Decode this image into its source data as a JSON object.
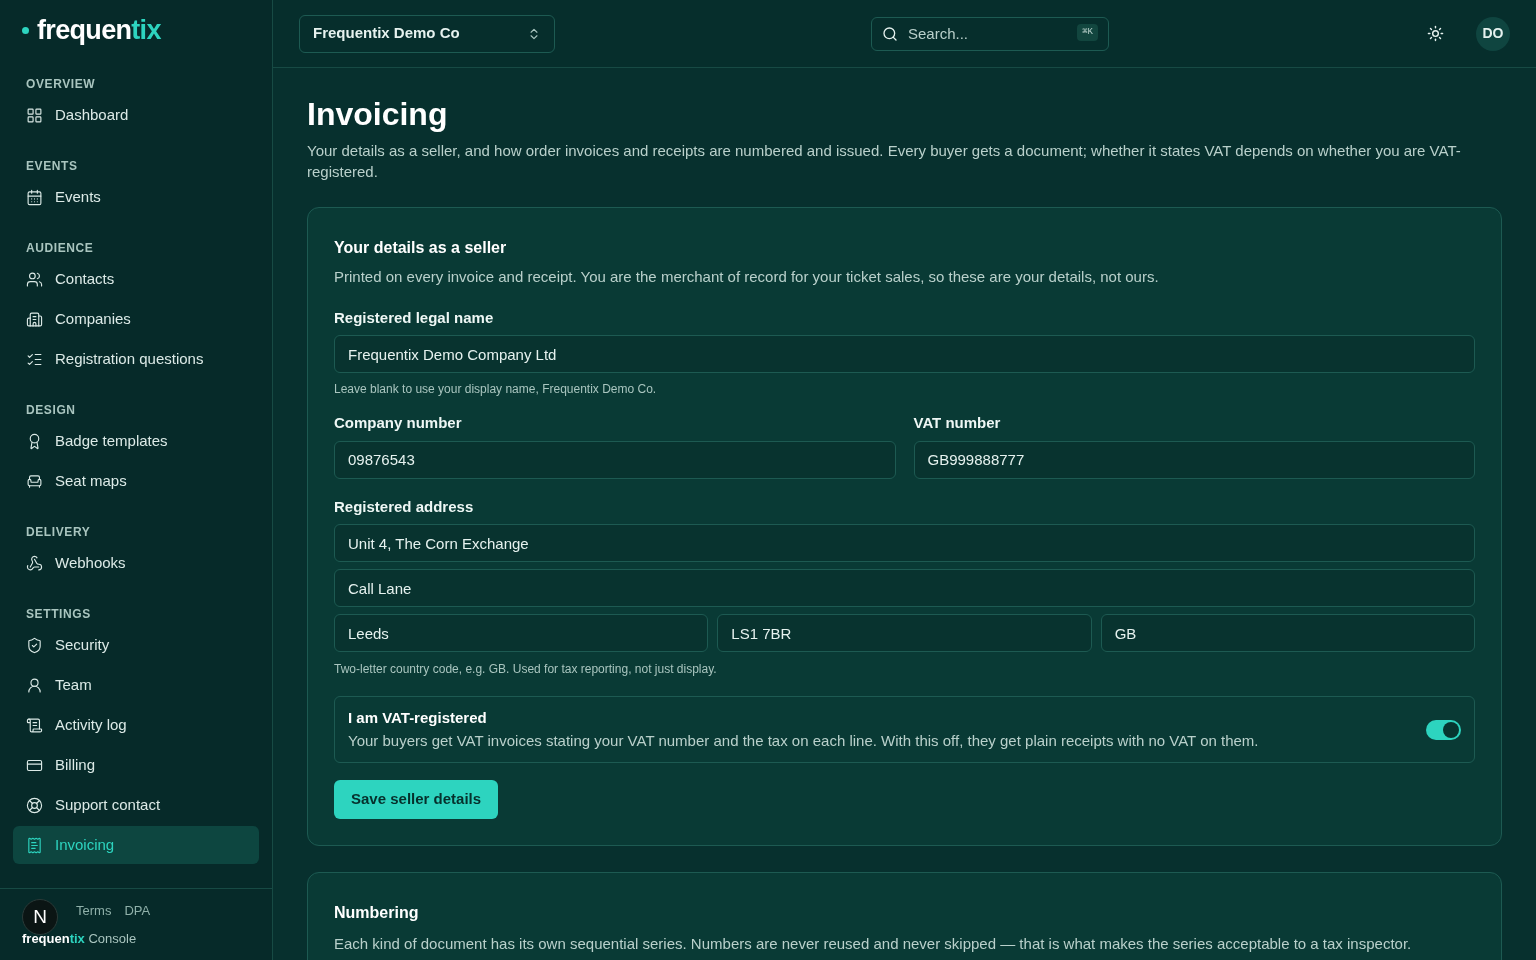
{
  "brand": {
    "name_a": "frequen",
    "name_b": "tix"
  },
  "sidebar": {
    "groups": [
      {
        "heading": "OVERVIEW",
        "items": [
          {
            "label": "Dashboard",
            "selected": false
          }
        ]
      },
      {
        "heading": "EVENTS",
        "items": [
          {
            "label": "Events",
            "selected": false
          }
        ]
      },
      {
        "heading": "AUDIENCE",
        "items": [
          {
            "label": "Contacts",
            "selected": false
          },
          {
            "label": "Companies",
            "selected": false
          },
          {
            "label": "Registration questions",
            "selected": false
          }
        ]
      },
      {
        "heading": "DESIGN",
        "items": [
          {
            "label": "Badge templates",
            "selected": false
          },
          {
            "label": "Seat maps",
            "selected": false
          }
        ]
      },
      {
        "heading": "DELIVERY",
        "items": [
          {
            "label": "Webhooks",
            "selected": false
          }
        ]
      },
      {
        "heading": "SETTINGS",
        "items": [
          {
            "label": "Security",
            "selected": false
          },
          {
            "label": "Team",
            "selected": false
          },
          {
            "label": "Activity log",
            "selected": false
          },
          {
            "label": "Billing",
            "selected": false
          },
          {
            "label": "Support contact",
            "selected": false
          },
          {
            "label": "Invoicing",
            "selected": true
          }
        ]
      }
    ],
    "footer_links": [
      "Terms",
      "DPA"
    ],
    "footer_brand": {
      "name_a": "frequen",
      "name_b": "tix",
      "suffix": "Console"
    },
    "dev_badge": "N"
  },
  "topbar": {
    "org": "Frequentix Demo Co",
    "search": {
      "placeholder": "Search...",
      "shortcut": "⌘K"
    },
    "avatar": "DO"
  },
  "page": {
    "title": "Invoicing",
    "description": "Your details as a seller, and how order invoices and receipts are numbered and issued. Every buyer gets a document; whether it states VAT depends on whether you are VAT-registered."
  },
  "seller": {
    "title": "Your details as a seller",
    "description": "Printed on every invoice and receipt. You are the merchant of record for your ticket sales, so these are your details, not ours.",
    "legal_name": {
      "label": "Registered legal name",
      "value": "Frequentix Demo Company Ltd",
      "hint": "Leave blank to use your display name, Frequentix Demo Co."
    },
    "company_number": {
      "label": "Company number",
      "value": "09876543"
    },
    "vat_number": {
      "label": "VAT number",
      "value": "GB999888777"
    },
    "address": {
      "label": "Registered address",
      "line1": "Unit 4, The Corn Exchange",
      "line2": "Call Lane",
      "city": "Leeds",
      "postcode": "LS1 7BR",
      "country": "GB",
      "hint": "Two-letter country code, e.g. GB. Used for tax reporting, not just display."
    },
    "vat_registered": {
      "label": "I am VAT-registered",
      "description": "Your buyers get VAT invoices stating your VAT number and the tax on each line. With this off, they get plain receipts with no VAT on them.",
      "on": true
    },
    "save": "Save seller details"
  },
  "numbering": {
    "title": "Numbering",
    "description": "Each kind of document has its own sequential series. Numbers are never reused and never skipped — that is what makes the series acceptable to a tax inspector."
  }
}
